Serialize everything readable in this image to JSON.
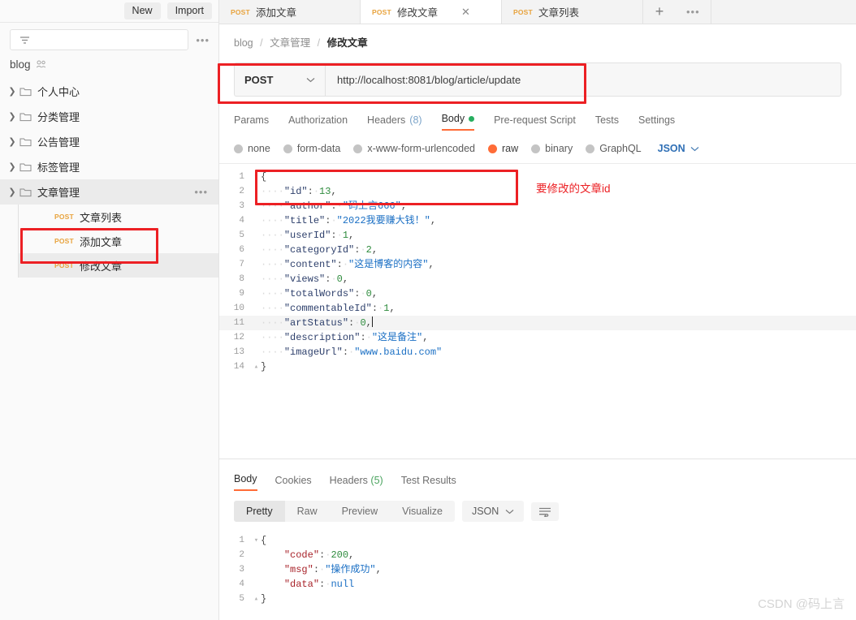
{
  "sidebar": {
    "buttons": {
      "new": "New",
      "import": "Import"
    },
    "filter_placeholder": "",
    "workspace": "blog",
    "folders": [
      {
        "label": "个人中心",
        "expanded": false
      },
      {
        "label": "分类管理",
        "expanded": false
      },
      {
        "label": "公告管理",
        "expanded": false
      },
      {
        "label": "标签管理",
        "expanded": false
      },
      {
        "label": "文章管理",
        "expanded": true
      }
    ],
    "requests": [
      {
        "method": "POST",
        "label": "文章列表",
        "active": false
      },
      {
        "method": "POST",
        "label": "添加文章",
        "active": false
      },
      {
        "method": "POST",
        "label": "修改文章",
        "active": true
      }
    ]
  },
  "tabs": [
    {
      "method": "POST",
      "title": "添加文章",
      "active": false,
      "closable": false
    },
    {
      "method": "POST",
      "title": "修改文章",
      "active": true,
      "closable": true
    },
    {
      "method": "POST",
      "title": "文章列表",
      "active": false,
      "closable": false
    }
  ],
  "breadcrumb": {
    "root": "blog",
    "folder": "文章管理",
    "current": "修改文章",
    "separator": "/"
  },
  "request": {
    "method": "POST",
    "url": "http://localhost:8081/blog/article/update",
    "tabs": [
      {
        "label": "Params",
        "active": false
      },
      {
        "label": "Authorization",
        "active": false
      },
      {
        "label": "Headers",
        "count": "(8)",
        "active": false
      },
      {
        "label": "Body",
        "active": true,
        "dot": true
      },
      {
        "label": "Pre-request Script",
        "active": false
      },
      {
        "label": "Tests",
        "active": false
      },
      {
        "label": "Settings",
        "active": false
      }
    ],
    "body_types": [
      {
        "label": "none",
        "selected": false
      },
      {
        "label": "form-data",
        "selected": false
      },
      {
        "label": "x-www-form-urlencoded",
        "selected": false
      },
      {
        "label": "raw",
        "selected": true
      },
      {
        "label": "binary",
        "selected": false
      },
      {
        "label": "GraphQL",
        "selected": false
      }
    ],
    "format": "JSON",
    "body_lines": [
      {
        "n": 1,
        "fold": "▾",
        "indent": "",
        "text": "{",
        "type": "punct"
      },
      {
        "n": 2,
        "fold": "",
        "indent": "····",
        "key": "\"id\"",
        "val": "13",
        "vtype": "num",
        "comma": ","
      },
      {
        "n": 3,
        "fold": "",
        "indent": "····",
        "key": "\"author\"",
        "val": "\"码上言666\"",
        "vtype": "str",
        "comma": ","
      },
      {
        "n": 4,
        "fold": "",
        "indent": "····",
        "key": "\"title\"",
        "val": "\"2022我要赚大钱！\"",
        "vtype": "str",
        "comma": ","
      },
      {
        "n": 5,
        "fold": "",
        "indent": "····",
        "key": "\"userId\"",
        "val": "1",
        "vtype": "num",
        "comma": ","
      },
      {
        "n": 6,
        "fold": "",
        "indent": "····",
        "key": "\"categoryId\"",
        "val": "2",
        "vtype": "num",
        "comma": ","
      },
      {
        "n": 7,
        "fold": "",
        "indent": "····",
        "key": "\"content\"",
        "val": "\"这是博客的内容\"",
        "vtype": "str",
        "comma": ","
      },
      {
        "n": 8,
        "fold": "",
        "indent": "····",
        "key": "\"views\"",
        "val": "0",
        "vtype": "num",
        "comma": ","
      },
      {
        "n": 9,
        "fold": "",
        "indent": "····",
        "key": "\"totalWords\"",
        "val": "0",
        "vtype": "num",
        "comma": ","
      },
      {
        "n": 10,
        "fold": "",
        "indent": "····",
        "key": "\"commentableId\"",
        "val": "1",
        "vtype": "num",
        "comma": ","
      },
      {
        "n": 11,
        "fold": "",
        "indent": "····",
        "key": "\"artStatus\"",
        "val": "0",
        "vtype": "num",
        "comma": ",",
        "cursor": true,
        "highlight": true
      },
      {
        "n": 12,
        "fold": "",
        "indent": "····",
        "key": "\"description\"",
        "val": "\"这是备注\"",
        "vtype": "str",
        "comma": ","
      },
      {
        "n": 13,
        "fold": "",
        "indent": "····",
        "key": "\"imageUrl\"",
        "val": "\"www.baidu.com\"",
        "vtype": "str",
        "comma": ""
      },
      {
        "n": 14,
        "fold": "▴",
        "indent": "",
        "text": "}",
        "type": "punct"
      }
    ]
  },
  "response": {
    "tabs": [
      {
        "label": "Body",
        "active": true
      },
      {
        "label": "Cookies",
        "active": false
      },
      {
        "label": "Headers",
        "count": "(5)",
        "active": false
      },
      {
        "label": "Test Results",
        "active": false
      }
    ],
    "views": [
      {
        "label": "Pretty",
        "active": true
      },
      {
        "label": "Raw",
        "active": false
      },
      {
        "label": "Preview",
        "active": false
      },
      {
        "label": "Visualize",
        "active": false
      }
    ],
    "format": "JSON",
    "body_lines": [
      {
        "n": 1,
        "fold": "▾",
        "indent": "",
        "text": "{",
        "type": "punct"
      },
      {
        "n": 2,
        "fold": "",
        "indent": "    ",
        "key": "\"code\"",
        "val": "200",
        "vtype": "num",
        "comma": ","
      },
      {
        "n": 3,
        "fold": "",
        "indent": "    ",
        "key": "\"msg\"",
        "val": "\"操作成功\"",
        "vtype": "str",
        "comma": ","
      },
      {
        "n": 4,
        "fold": "",
        "indent": "    ",
        "key": "\"data\"",
        "val": "null",
        "vtype": "str",
        "comma": ""
      },
      {
        "n": 5,
        "fold": "▴",
        "indent": "",
        "text": "}",
        "type": "punct"
      }
    ]
  },
  "annotations": [
    {
      "name": "url-highlight",
      "note": ""
    },
    {
      "name": "id-highlight",
      "note": ""
    },
    {
      "name": "sidebar-highlight",
      "note": ""
    }
  ],
  "annotation_text": "要修改的文章id",
  "watermark": "CSDN @码上言",
  "colors": {
    "accent": "#ff6c37",
    "annotation": "#ec2024",
    "method_post": "#e8a33d",
    "json_key": "#2d3f6b",
    "json_string": "#1a6fc4",
    "json_number": "#2e8b3d",
    "resp_key": "#a8232a",
    "body_dot": "#27ae60"
  }
}
